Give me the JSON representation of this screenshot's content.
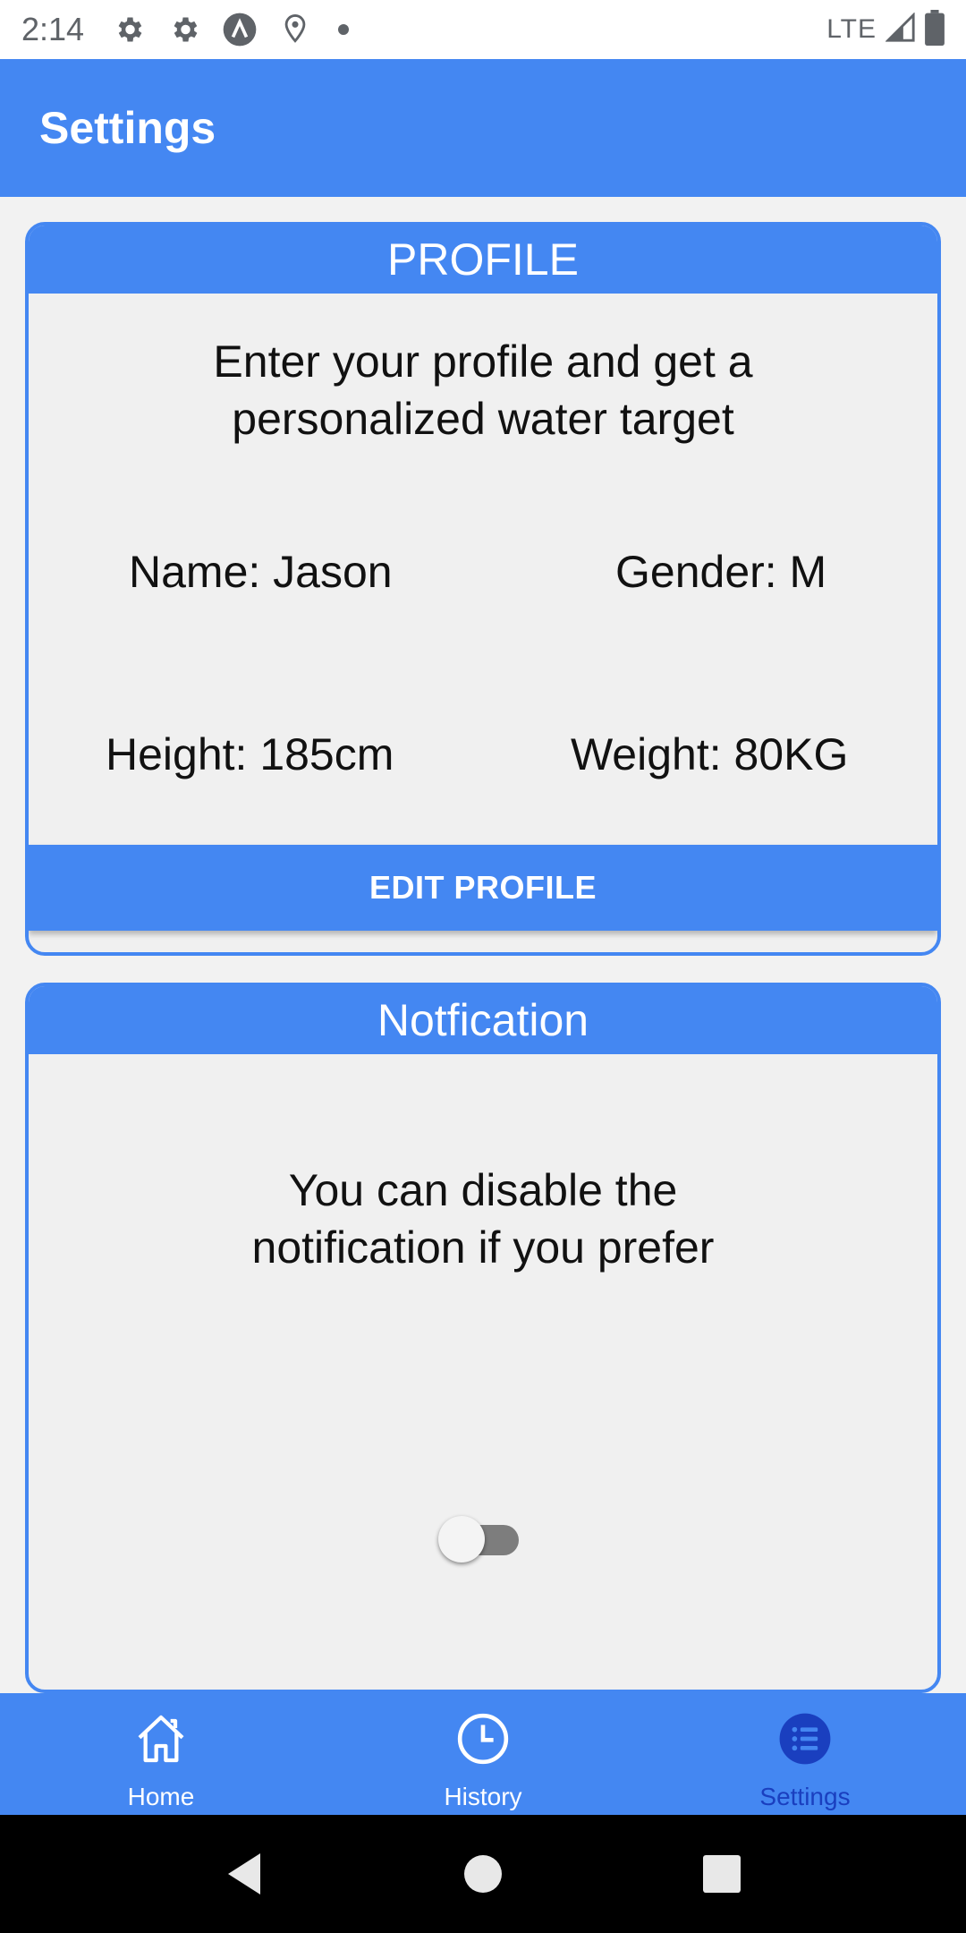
{
  "status_bar": {
    "time": "2:14",
    "network": "LTE",
    "icons": [
      "settings-gear-icon",
      "settings-gear-icon",
      "app-a-icon",
      "location-pin-icon",
      "notification-dot-icon",
      "signal-icon",
      "battery-icon"
    ]
  },
  "app_bar": {
    "title": "Settings"
  },
  "profile_card": {
    "header": "PROFILE",
    "description": "Enter your profile and get a personalized water target",
    "name": "Name: Jason",
    "gender": "Gender: M",
    "height": "Height: 185cm",
    "weight": "Weight: 80KG",
    "edit_button": "EDIT PROFILE"
  },
  "notification_card": {
    "header": "Notfication",
    "description": "You can disable the notification if you prefer",
    "toggle_on": false
  },
  "tab_bar": {
    "tabs": [
      {
        "label": "Home",
        "icon": "home-icon",
        "active": false
      },
      {
        "label": "History",
        "icon": "clock-icon",
        "active": false
      },
      {
        "label": "Settings",
        "icon": "list-icon",
        "active": true
      }
    ]
  },
  "colors": {
    "primary": "#4487f2",
    "active_tab": "#1a3fbf",
    "card_bg": "#f0f0f0"
  }
}
